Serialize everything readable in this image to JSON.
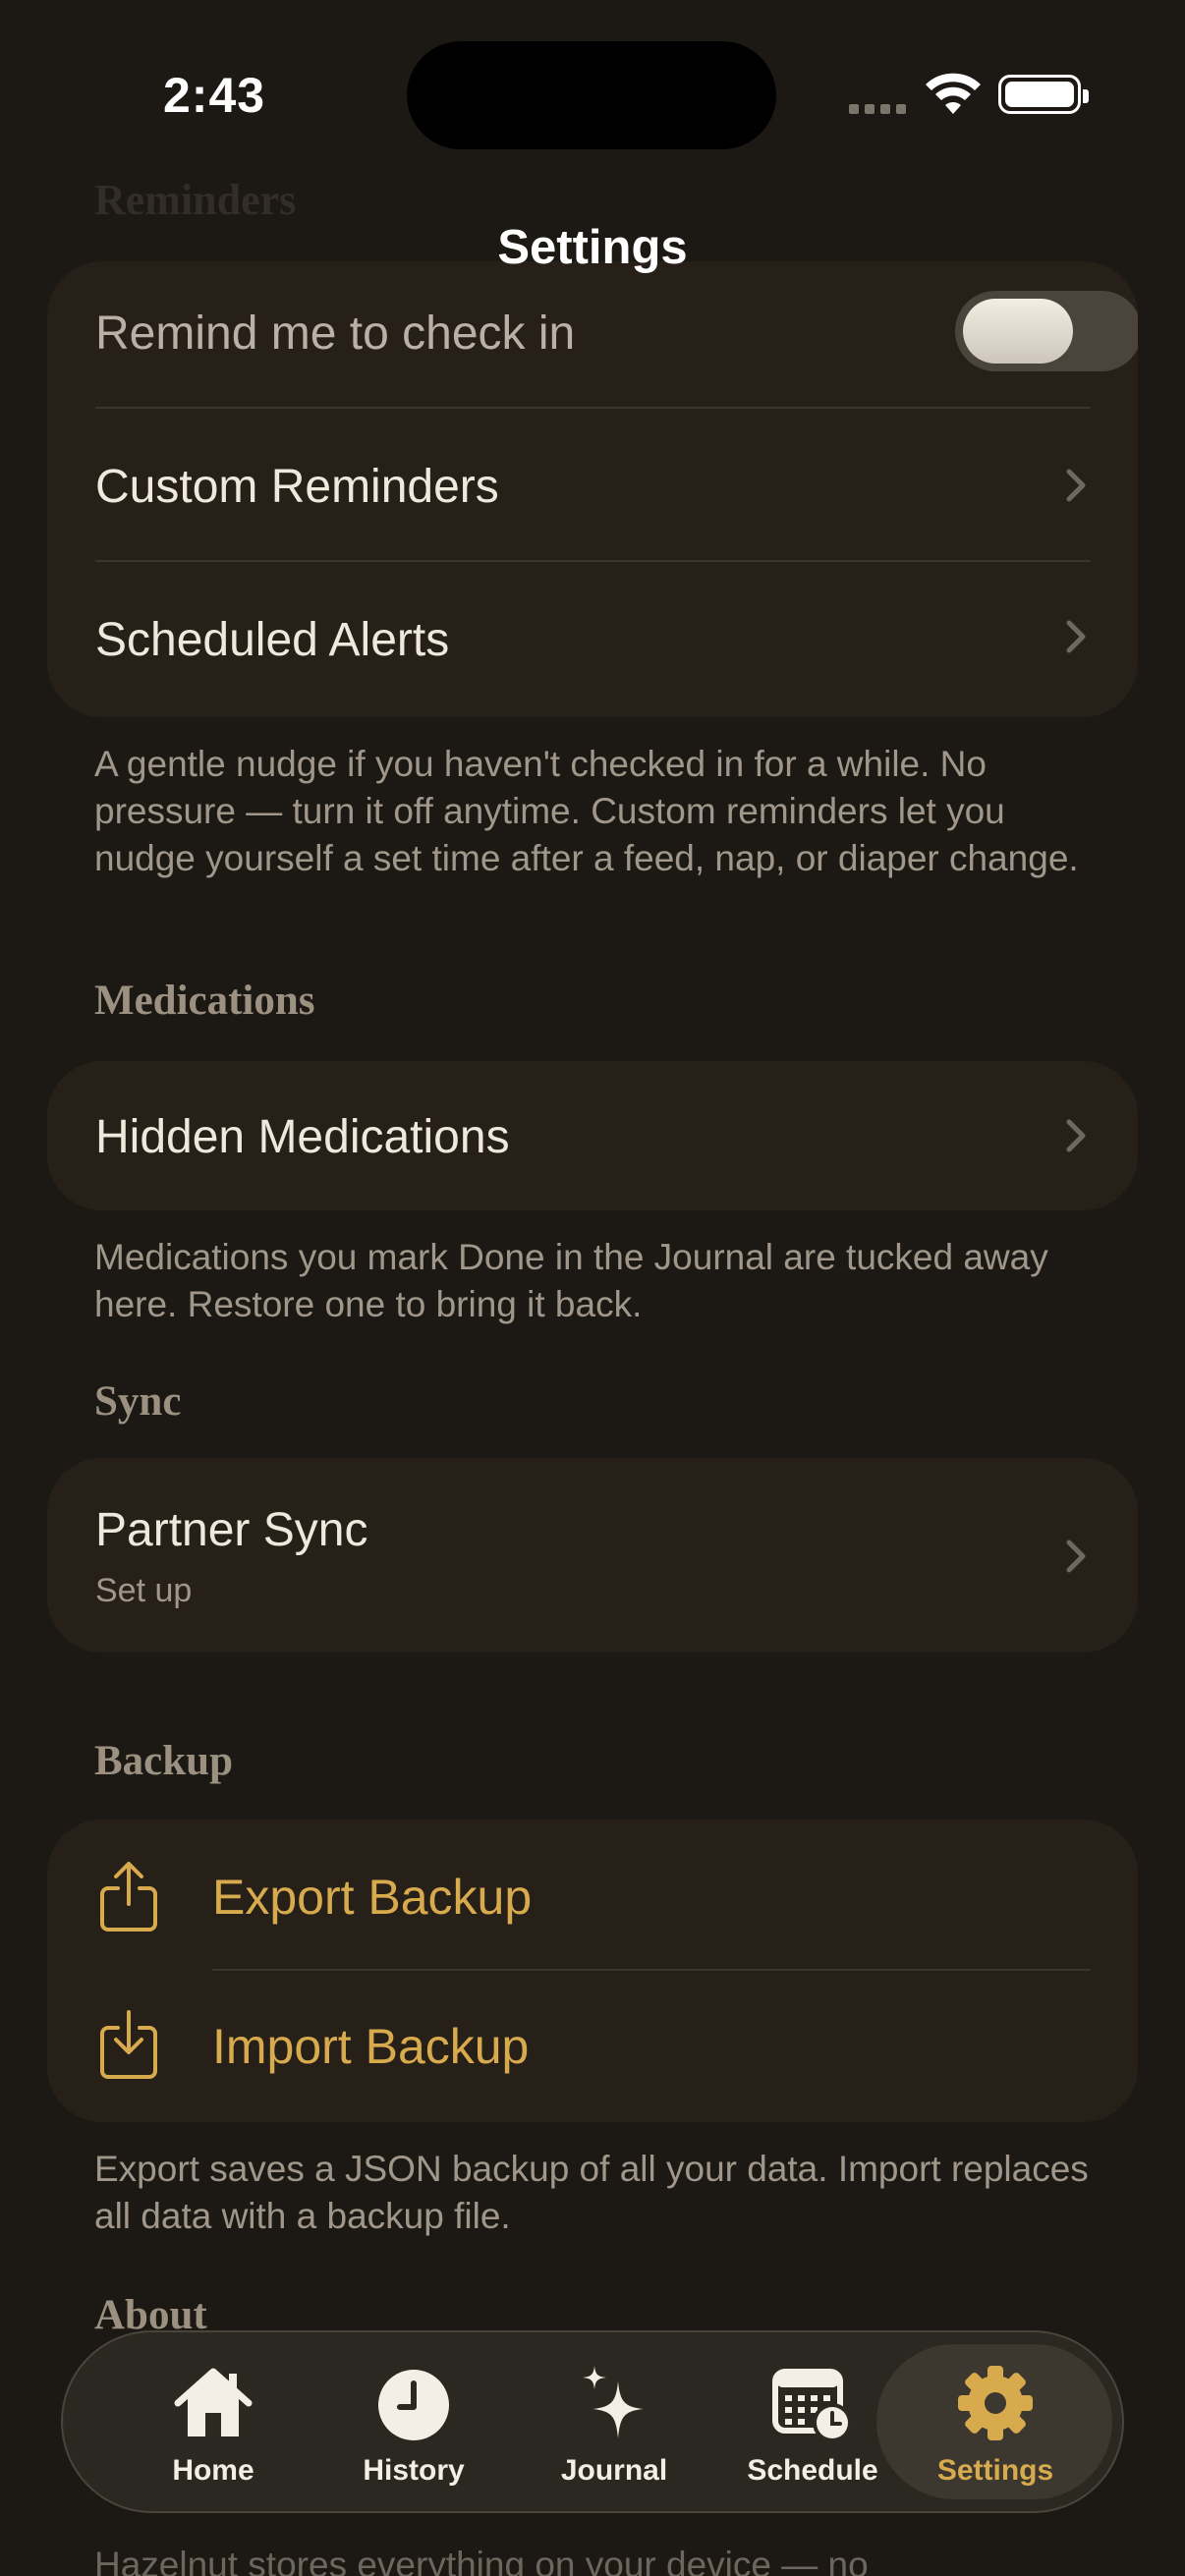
{
  "status_bar": {
    "time": "2:43"
  },
  "nav": {
    "title": "Settings"
  },
  "ghost": {
    "previous_section": "Reminders"
  },
  "reminders": {
    "items": [
      {
        "label": "Remind me to check in",
        "toggle_on": true
      },
      {
        "label": "Custom Reminders"
      },
      {
        "label": "Scheduled Alerts"
      }
    ],
    "footer": "A gentle nudge if you haven't checked in for a while. No pressure — turn it off anytime. Custom reminders let you nudge yourself a set time after a feed, nap, or diaper change."
  },
  "medications": {
    "header": "Medications",
    "items": [
      {
        "label": "Hidden Medications"
      }
    ],
    "footer": "Medications you mark Done in the Journal are tucked away here. Restore one to bring it back."
  },
  "sync": {
    "header": "Sync",
    "items": [
      {
        "label": "Partner Sync",
        "subtitle": "Set up"
      }
    ]
  },
  "backup": {
    "header": "Backup",
    "items": [
      {
        "label": "Export Backup",
        "icon": "share-icon"
      },
      {
        "label": "Import Backup",
        "icon": "download-icon"
      }
    ],
    "footer": "Export saves a JSON backup of all your data. Import replaces all data with a backup file."
  },
  "about": {
    "header": "About",
    "footer_partial": "Hazelnut stores everything on your device — no"
  },
  "tabbar": {
    "tabs": [
      {
        "label": "Home",
        "icon": "house-icon"
      },
      {
        "label": "History",
        "icon": "clock-icon"
      },
      {
        "label": "Journal",
        "icon": "sparkles-icon"
      },
      {
        "label": "Schedule",
        "icon": "calendar-clock-icon"
      },
      {
        "label": "Settings",
        "icon": "gear-icon",
        "active": true
      }
    ]
  },
  "colors": {
    "background": "#1c1915",
    "card": "#272019",
    "accent": "#d8aa4e",
    "section_header": "#9c9181",
    "secondary_text": "#a0978a"
  }
}
